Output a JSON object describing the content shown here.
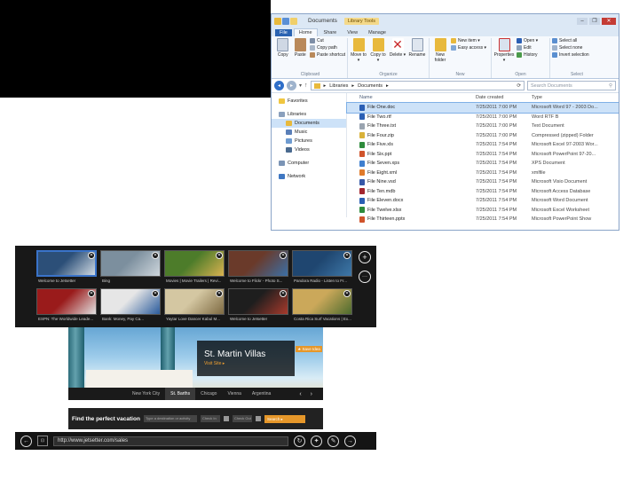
{
  "explorer": {
    "title": "Documents",
    "context_tab": "Library Tools",
    "window_controls": [
      "–",
      "❐",
      "✕"
    ],
    "ribbon_tabs": [
      "File",
      "Home",
      "Share",
      "View",
      "Manage"
    ],
    "groups": {
      "clipboard": {
        "label": "Clipboard",
        "copy": "Copy",
        "paste": "Paste",
        "cut": "Cut",
        "copy_path": "Copy path",
        "paste_shortcut": "Paste shortcut"
      },
      "organize": {
        "label": "Organize",
        "move_to": "Move to ▾",
        "copy_to": "Copy to ▾",
        "delete": "Delete ▾",
        "rename": "Rename"
      },
      "new": {
        "label": "New",
        "new_folder": "New folder",
        "new_item": "New item ▾",
        "easy_access": "Easy access ▾"
      },
      "open": {
        "label": "Open",
        "properties": "Properties ▾",
        "open": "Open ▾",
        "edit": "Edit",
        "history": "History"
      },
      "select": {
        "label": "Select",
        "select_all": "Select all",
        "select_none": "Select none",
        "invert_selection": "Invert selection"
      }
    },
    "address": {
      "segments": [
        "▸",
        "Libraries",
        "▸",
        "Documents",
        "▸"
      ],
      "search_placeholder": "Search Documents"
    },
    "nav": {
      "favorites": "Favorites",
      "libraries": "Libraries",
      "library_items": [
        "Documents",
        "Music",
        "Pictures",
        "Videos"
      ],
      "computer": "Computer",
      "network": "Network"
    },
    "columns": [
      "Name",
      "Date created",
      "Type"
    ],
    "files": [
      {
        "name": "File One.doc",
        "date": "7/25/2011 7:00 PM",
        "type": "Microsoft Word 97 - 2003 Do...",
        "color": "#2b5fb4"
      },
      {
        "name": "File Two.rtf",
        "date": "7/25/2011 7:00 PM",
        "type": "Word RTF B",
        "color": "#2b5fb4"
      },
      {
        "name": "File Three.txt",
        "date": "7/25/2011 7:00 PM",
        "type": "Text Document",
        "color": "#9aa4b0"
      },
      {
        "name": "File Four.zip",
        "date": "7/25/2011 7:00 PM",
        "type": "Compressed (zipped) Folder",
        "color": "#d9b23a"
      },
      {
        "name": "File Five.xls",
        "date": "7/25/2011 7:54 PM",
        "type": "Microsoft Excel 97-2003 Wor...",
        "color": "#2e8b3c"
      },
      {
        "name": "File Six.ppt",
        "date": "7/25/2011 7:54 PM",
        "type": "Microsoft PowerPoint 97-20...",
        "color": "#d0542b"
      },
      {
        "name": "File Seven.xps",
        "date": "7/25/2011 7:54 PM",
        "type": "XPS Document",
        "color": "#3f7fcf"
      },
      {
        "name": "File Eight.xml",
        "date": "7/25/2011 7:54 PM",
        "type": "xmlfile",
        "color": "#e07a2a"
      },
      {
        "name": "File Nine.vsd",
        "date": "7/25/2011 7:54 PM",
        "type": "Microsoft Visio Document",
        "color": "#3558a8"
      },
      {
        "name": "File Ten.mdb",
        "date": "7/25/2011 7:54 PM",
        "type": "Microsoft Access Database",
        "color": "#a3262f"
      },
      {
        "name": "File Eleven.docx",
        "date": "7/25/2011 7:54 PM",
        "type": "Microsoft Word Document",
        "color": "#2b5fb4"
      },
      {
        "name": "File Twelve.xlsx",
        "date": "7/25/2011 7:54 PM",
        "type": "Microsoft Excel Worksheet",
        "color": "#2e8b3c"
      },
      {
        "name": "File Thirteen.pptx",
        "date": "7/25/2011 7:54 PM",
        "type": "Microsoft PowerPoint Show",
        "color": "#d0542b"
      }
    ]
  },
  "ie": {
    "tabs": [
      {
        "caption": "Welcome to Jetsetter",
        "active": true,
        "c1": "#2c4f78",
        "c2": "#cfd9e2"
      },
      {
        "caption": "Bing",
        "active": false,
        "c1": "#7c8f9e",
        "c2": "#ced6dc"
      },
      {
        "caption": "Movies | Movie Trailers | Revi...",
        "active": false,
        "c1": "#4d7c2a",
        "c2": "#d9b250"
      },
      {
        "caption": "Welcome to Flickr - Photo S...",
        "active": false,
        "c1": "#6a3a2a",
        "c2": "#3b6fa6"
      },
      {
        "caption": "Pandora Radio - Listen to Fr...",
        "active": false,
        "c1": "#1f4670",
        "c2": "#3e78a8"
      },
      {
        "caption": "ESPN: The Worldwide Leade...",
        "active": false,
        "c1": "#9a1b1b",
        "c2": "#e2e2e2"
      },
      {
        "caption": "Bank: Money, Pay Ca...",
        "active": false,
        "c1": "#e6e6e6",
        "c2": "#2a5b9c"
      },
      {
        "caption": "Yaytar Love Dancer Kabul M...",
        "active": false,
        "c1": "#d4c7a2",
        "c2": "#7e6a42"
      },
      {
        "caption": "Welcome to Jetsetter",
        "active": false,
        "c1": "#1e1e1e",
        "c2": "#a83a2c"
      },
      {
        "caption": "Costa Rica Surf Vacations | Ex...",
        "active": false,
        "c1": "#cba85a",
        "c2": "#4d6b2e"
      }
    ],
    "tab_buttons": {
      "new_tab": "+",
      "more": "···"
    },
    "hero": {
      "title": "St. Martin Villas",
      "link": "Visit Site ▸",
      "badge": "★ Save Idea"
    },
    "cities": [
      "New York City",
      "St. Barths",
      "Chicago",
      "Vienna",
      "Argentina"
    ],
    "city_arrows": "‹ ›",
    "find": {
      "label": "Find the perfect vacation",
      "dest": "Type a destination or activity",
      "checkin": "Check In",
      "checkout": "Check Out",
      "search": "Search ▸"
    },
    "appbar": {
      "back": "←",
      "page": "⊡",
      "url": "http://www.jetsetter.com/sales",
      "refresh": "↻",
      "pin": "✦",
      "tools": "✎",
      "forward": "→"
    }
  }
}
